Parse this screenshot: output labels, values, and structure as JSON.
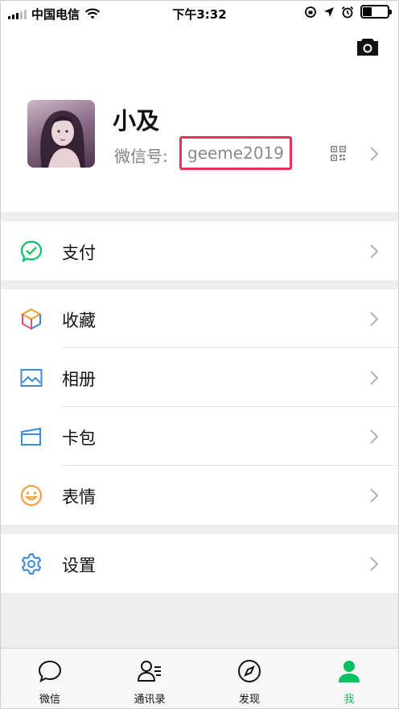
{
  "status_bar": {
    "carrier": "中国电信",
    "time": "下午3:32"
  },
  "profile": {
    "name": "小及",
    "wechat_id_label": "微信号:",
    "wechat_id": "geeme2019"
  },
  "menu": {
    "pay": "支付",
    "favorites": "收藏",
    "album": "相册",
    "cards": "卡包",
    "stickers": "表情",
    "settings": "设置"
  },
  "tabs": [
    {
      "label": "微信"
    },
    {
      "label": "通讯录"
    },
    {
      "label": "发现"
    },
    {
      "label": "我"
    }
  ],
  "colors": {
    "accent": "#07c160",
    "highlight_box": "#e7305a"
  }
}
